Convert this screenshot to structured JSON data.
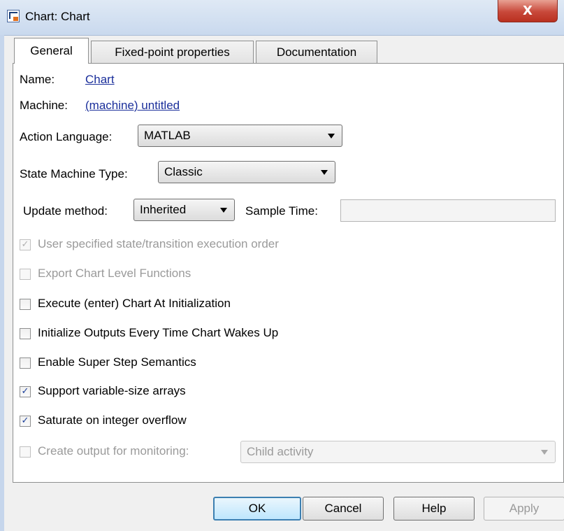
{
  "window": {
    "title": "Chart: Chart",
    "close_glyph": "X"
  },
  "tabs": [
    {
      "label": "General",
      "active": true
    },
    {
      "label": "Fixed-point properties",
      "active": false
    },
    {
      "label": "Documentation",
      "active": false
    }
  ],
  "general": {
    "name_label": "Name:",
    "name_value": "Chart",
    "machine_label": "Machine:",
    "machine_value": "(machine) untitled",
    "action_language_label": "Action Language:",
    "action_language_value": "MATLAB",
    "state_machine_type_label": "State Machine Type:",
    "state_machine_type_value": "Classic",
    "update_method_label": "Update method:",
    "update_method_value": "Inherited",
    "sample_time_label": "Sample Time:",
    "sample_time_value": "",
    "monitoring_select_value": "Child activity"
  },
  "checkboxes": [
    {
      "label": "User specified state/transition execution order",
      "checked": true,
      "enabled": false
    },
    {
      "label": "Export Chart Level Functions",
      "checked": false,
      "enabled": false
    },
    {
      "label": "Execute (enter) Chart At Initialization",
      "checked": false,
      "enabled": true
    },
    {
      "label": "Initialize Outputs Every Time Chart Wakes Up",
      "checked": false,
      "enabled": true
    },
    {
      "label": "Enable Super Step Semantics",
      "checked": false,
      "enabled": true
    },
    {
      "label": "Support variable-size arrays",
      "checked": true,
      "enabled": true
    },
    {
      "label": "Saturate on integer overflow",
      "checked": true,
      "enabled": true
    },
    {
      "label": "Create output for monitoring:",
      "checked": false,
      "enabled": false
    }
  ],
  "buttons": {
    "ok": "OK",
    "cancel": "Cancel",
    "help": "Help",
    "apply": "Apply"
  },
  "colors": {
    "link": "#1b2f9b",
    "disabled_text": "#9a9a9a",
    "default_button_border": "#3c7fb1"
  },
  "icons": {
    "check_glyph": "✓"
  }
}
